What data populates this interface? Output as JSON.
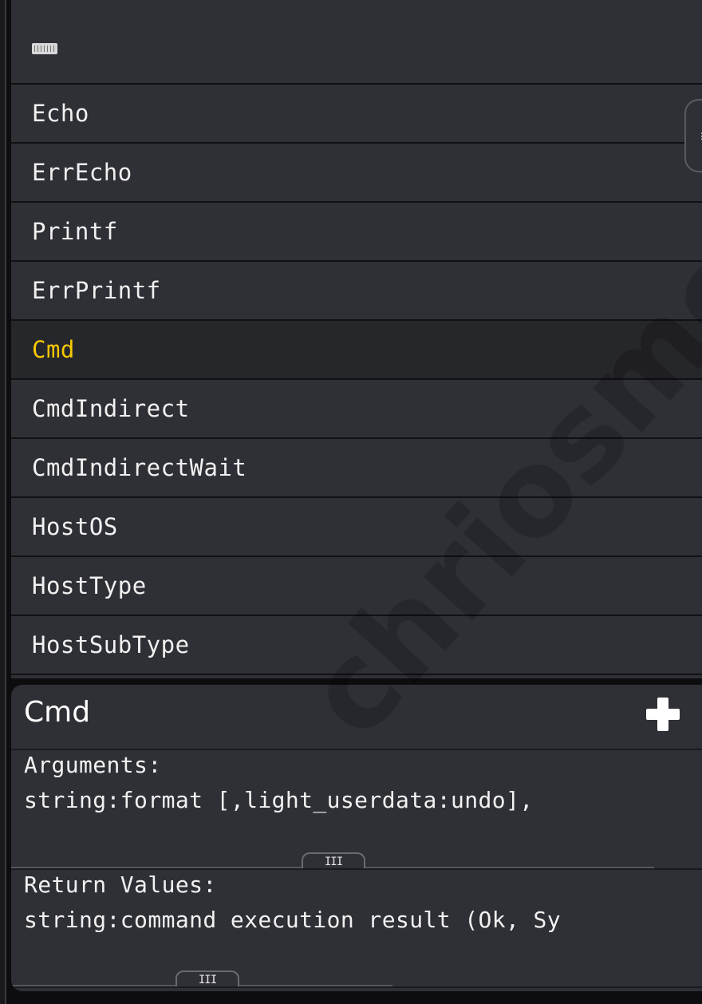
{
  "toolbar": {
    "icon": "keyboard-icon"
  },
  "side_handle": {
    "icon": "menu-lines-icon",
    "glyph": "≡"
  },
  "list": {
    "items": [
      {
        "label": "Echo",
        "selected": false
      },
      {
        "label": "ErrEcho",
        "selected": false
      },
      {
        "label": "Printf",
        "selected": false
      },
      {
        "label": "ErrPrintf",
        "selected": false
      },
      {
        "label": "Cmd",
        "selected": true
      },
      {
        "label": "CmdIndirect",
        "selected": false
      },
      {
        "label": "CmdIndirectWait",
        "selected": false
      },
      {
        "label": "HostOS",
        "selected": false
      },
      {
        "label": "HostType",
        "selected": false
      },
      {
        "label": "HostSubType",
        "selected": false
      }
    ]
  },
  "doc": {
    "title": "Cmd",
    "add_icon": "plus-icon",
    "arguments": {
      "heading": "Arguments:",
      "text": "string:format [,light_userdata:undo],"
    },
    "return_values": {
      "heading": "Return Values:",
      "text": "string:command execution result (Ok, Sy"
    },
    "grip_glyph": "III"
  },
  "watermark": {
    "text": "chriosmendo"
  },
  "colors": {
    "panel": "#2f3036",
    "selected_text": "#f6c800",
    "text": "#f1f1f1",
    "divider": "#111114"
  }
}
